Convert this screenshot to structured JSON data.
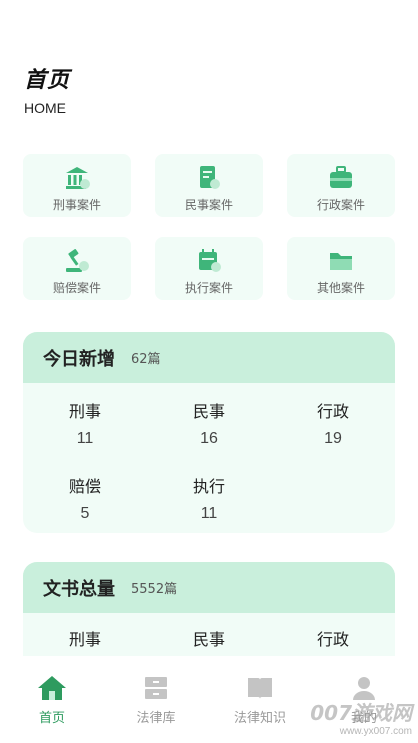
{
  "header": {
    "title": "首页",
    "subtitle": "HOME"
  },
  "categories": [
    {
      "label": "刑事案件",
      "icon": "bank-icon"
    },
    {
      "label": "民事案件",
      "icon": "document-icon"
    },
    {
      "label": "行政案件",
      "icon": "briefcase-icon"
    },
    {
      "label": "赔偿案件",
      "icon": "gavel-icon"
    },
    {
      "label": "执行案件",
      "icon": "calendar-icon"
    },
    {
      "label": "其他案件",
      "icon": "folder-icon"
    }
  ],
  "today": {
    "title": "今日新增",
    "count": "62篇",
    "stats": [
      {
        "name": "刑事",
        "value": "11"
      },
      {
        "name": "民事",
        "value": "16"
      },
      {
        "name": "行政",
        "value": "19"
      },
      {
        "name": "赔偿",
        "value": "5"
      },
      {
        "name": "执行",
        "value": "11"
      }
    ]
  },
  "total": {
    "title": "文书总量",
    "count": "5552篇",
    "stats": [
      {
        "name": "刑事"
      },
      {
        "name": "民事"
      },
      {
        "name": "行政"
      }
    ]
  },
  "tabbar": {
    "tabs": [
      {
        "label": "首页",
        "icon": "home-icon",
        "active": true
      },
      {
        "label": "法律库",
        "icon": "cabinet-icon"
      },
      {
        "label": "法律知识",
        "icon": "book-icon"
      },
      {
        "label": "我的",
        "icon": "person-icon"
      }
    ]
  },
  "watermark": {
    "big": "007游戏网",
    "small": "www.yx007.com"
  },
  "colors": {
    "accent": "#2e9b5f",
    "tile_bg": "#f1fcf7",
    "card_header": "#c9efdc",
    "icon_green": "#4cc48a"
  }
}
